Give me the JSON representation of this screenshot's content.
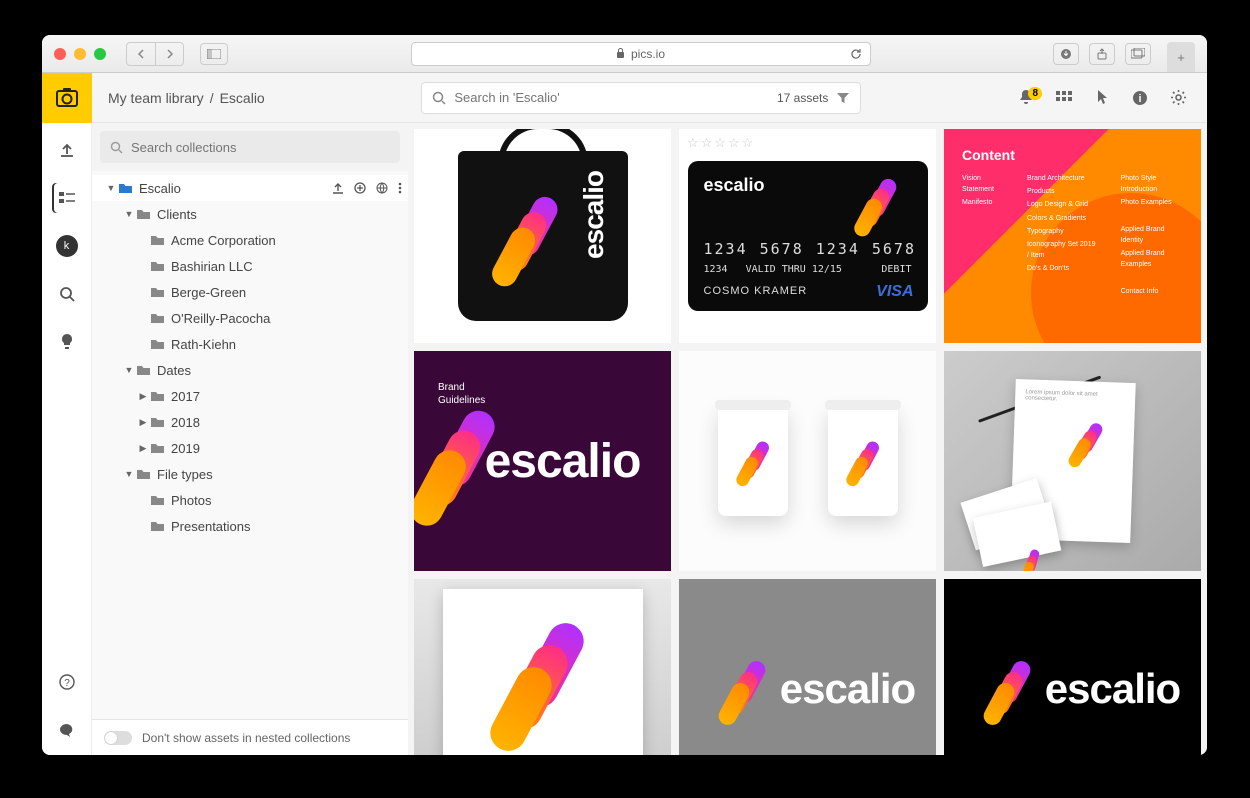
{
  "browser": {
    "url_host": "pics.io",
    "secure": true
  },
  "header": {
    "breadcrumb_root": "My team library",
    "breadcrumb_sep": "/",
    "breadcrumb_current": "Escalio",
    "search_placeholder": "Search in 'Escalio'",
    "assets_count": "17 assets",
    "notif_badge": "8"
  },
  "sidebar": {
    "search_placeholder": "Search collections",
    "tree": {
      "root": {
        "label": "Escalio",
        "expanded": true,
        "selected": true
      },
      "clients": {
        "label": "Clients",
        "expanded": true,
        "children": [
          "Acme Corporation",
          "Bashirian LLC",
          "Berge-Green",
          "O'Reilly-Pacocha",
          "Rath-Kiehn"
        ]
      },
      "dates": {
        "label": "Dates",
        "expanded": true,
        "children": [
          "2017",
          "2018",
          "2019"
        ]
      },
      "filetypes": {
        "label": "File types",
        "expanded": true,
        "children": [
          "Photos",
          "Presentations"
        ]
      }
    },
    "footer_toggle_label": "Don't show assets in nested collections"
  },
  "cards": {
    "brand_word": "escalio",
    "content_slide_title": "Content",
    "guidelines_label_l1": "Brand",
    "guidelines_label_l2": "Guidelines",
    "credit_card": {
      "numbers": [
        "1234",
        "5678",
        "1234",
        "5678"
      ],
      "code": "1234",
      "label_valid": "VALID THRU",
      "exp": "12/15",
      "debit": "DEBIT",
      "holder": "COSMO KRAMER",
      "network": "VISA"
    }
  }
}
